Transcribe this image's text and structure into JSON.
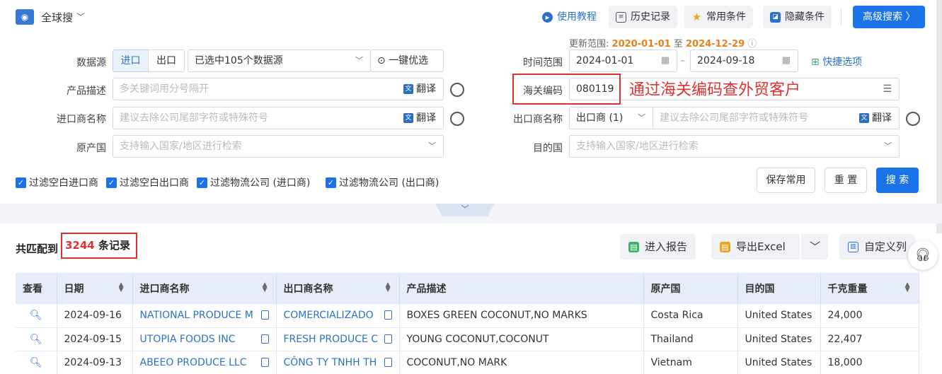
{
  "topbar": {
    "scope_label": "全球搜",
    "tutorial": "使用教程",
    "history": "历史记录",
    "common": "常用条件",
    "hide": "隐藏条件",
    "advanced": "高级搜索 〉"
  },
  "update_range": {
    "prefix": "更新范围:",
    "start": "2020-01-01",
    "mid": "至",
    "end": "2024-12-29"
  },
  "form": {
    "datasource_label": "数据源",
    "import_tab": "进口",
    "export_tab": "出口",
    "datasource_selected": "已选中105个数据源",
    "one_click": "一键优选",
    "product_label": "产品描述",
    "product_placeholder": "多关键词用分号隔开",
    "translate": "翻译",
    "importer_label": "进口商名称",
    "importer_placeholder": "建议去除公司尾部字符或特殊符号",
    "origin_label": "原产国",
    "origin_placeholder": "支持输入国家/地区进行检索",
    "time_label": "时间范围",
    "date_start": "2024-01-01",
    "date_end": "2024-09-18",
    "quick_options": "快捷选项",
    "hs_label": "海关编码",
    "hs_value": "080119",
    "hs_overlay": "通过海关编码查外贸客户",
    "exporter_label": "出口商名称",
    "exporter_select": "出口商 (1)",
    "exporter_placeholder": "建议去除公司尾部字符或特殊符号",
    "destination_label": "目的国",
    "destination_placeholder": "支持输入国家/地区进行检索"
  },
  "filters": [
    {
      "label": "过滤空白进口商",
      "checked": true
    },
    {
      "label": "过滤空白出口商",
      "checked": true
    },
    {
      "label": "过滤物流公司 (进口商)",
      "checked": true
    },
    {
      "label": "过滤物流公司 (出口商)",
      "checked": true
    }
  ],
  "actions": {
    "save": "保存常用",
    "reset": "重 置",
    "search": "搜 索"
  },
  "results": {
    "prefix": "共匹配到",
    "count": "3244",
    "suffix": "条记录",
    "report": "进入报告",
    "export": "导出Excel",
    "custom_cols": "自定义列"
  },
  "table": {
    "headers": [
      "查看",
      "日期",
      "进口商名称",
      "出口商名称",
      "产品描述",
      "原产国",
      "目的国",
      "千克重量"
    ],
    "rows": [
      [
        "2024-09-16",
        "NATIONAL PRODUCE M",
        "COMERCIALIZADO",
        "BOXES GREEN COCONUT,NO MARKS",
        "Costa Rica",
        "United States",
        "24,000"
      ],
      [
        "2024-09-15",
        "UTOPIA FOODS INC",
        "FRESH PRODUCE C",
        "YOUNG COCONUT,COCONUT",
        "Thailand",
        "United States",
        "22,407"
      ],
      [
        "2024-09-13",
        "ABEEO PRODUCE LLC",
        "CÔNG TY TNHH TH",
        "COCONUT,NO MARK",
        "Vietnam",
        "United States",
        "18,000"
      ]
    ]
  },
  "colors": {
    "primary": "#1a73e8",
    "link": "#2b73c7",
    "highlight_red": "#e03131",
    "range_orange": "#e8811a"
  }
}
